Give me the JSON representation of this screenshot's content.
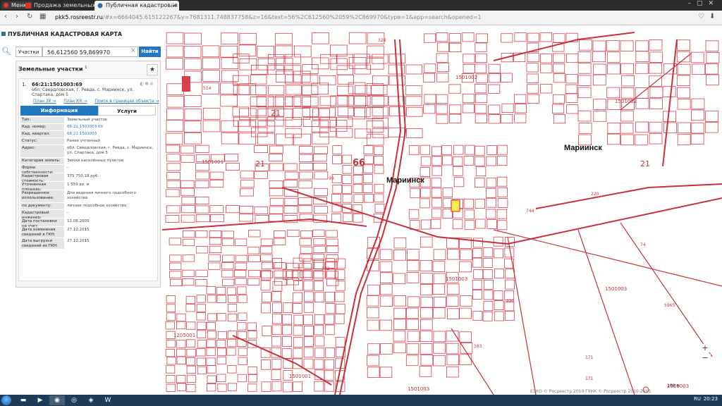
{
  "browser": {
    "menu_label": "Меню",
    "tabs": [
      {
        "title": "Продажа земельных уч..."
      },
      {
        "title": "Публичная кадастровая к..."
      }
    ],
    "new_tab": "+",
    "url_host": "pkk5.rosreestr.ru",
    "url_rest": "/#x=6664045.615122267&y=7681311.748837758&z=16&text=56%2C612560%2059%2C869970&type=1&app=search&opened=1"
  },
  "app": {
    "title": "ПУБЛИЧНАЯ КАДАСТРОВАЯ КАРТА",
    "search_type": "Участки",
    "search_query": "56,612560 59,869970",
    "search_button": "Найти",
    "results_title": "Земельные участки",
    "results_count": "1"
  },
  "parcel": {
    "index": "1.",
    "id": "66:21:1501003:69",
    "address": "обл. Свердловская, г. Ревда, с. Мариинск, ул. Спартака, дом 5",
    "link_plan_zu": "План ЗУ →",
    "link_plan_kk": "План КК →",
    "link_search_bounds": "Поиск в границах объекта →",
    "tab_info": "Информация",
    "tab_services": "Услуги",
    "fields": [
      {
        "k": "Тип:",
        "v": "Земельный участок"
      },
      {
        "k": "Кад. номер:",
        "v": "66:21:1501003:69",
        "link": true
      },
      {
        "k": "Кад. квартал:",
        "v": "66:21:1501003",
        "link": true
      },
      {
        "k": "Статус:",
        "v": "Ранее учтенный"
      },
      {
        "k": "Адрес:",
        "v": "обл. Свердловская, г. Ревда, с. Мариинск, ул. Спартака, дом 5"
      },
      {
        "k": "Категория земель:",
        "v": "Земли населённых пунктов"
      },
      {
        "k": "Форма собственности:",
        "v": "-"
      },
      {
        "k": "Кадастровая стоимость:",
        "v": "375 750,18 руб."
      },
      {
        "k": "Уточненная площадь:",
        "v": "1 559 кв. м"
      },
      {
        "k": "Разрешенное использование:",
        "v": "Для ведения личного подсобного хозяйства"
      },
      {
        "k": "по документу:",
        "v": "личное подсобное хозяйство"
      },
      {
        "k": "Кадастровый инженер:",
        "v": "-"
      },
      {
        "k": "Дата постановки на учет:",
        "v": "12.08.2005"
      },
      {
        "k": "Дата изменения сведений в ГКН:",
        "v": "27.10.2015"
      },
      {
        "k": "Дата выгрузки сведений из ГКН:",
        "v": "27.10.2015"
      }
    ]
  },
  "map": {
    "places": [
      "Мариинск",
      "Мариинск"
    ],
    "big_numbers": [
      "66",
      "21",
      "21",
      "21"
    ],
    "quarters": [
      "1501002",
      "1501002",
      "1501001",
      "1501003",
      "1501003",
      "1501003",
      "1205001",
      "1501001",
      "1501003",
      "1501003"
    ],
    "small_labels": [
      "328",
      "514",
      "220",
      "744",
      "74",
      "122",
      "220",
      "5965",
      "171",
      "171",
      "163",
      "99"
    ],
    "copyright": "ЕЭКО © Росреестр 2010 ГУНК © Росреестр 2010-2015",
    "scale": "100 м",
    "zoom_in": "+",
    "zoom_out": "−"
  },
  "taskbar": {
    "lang": "RU",
    "time": "20:23"
  },
  "colors": {
    "parcel_line": "#d8404a",
    "selected_parcel": "#f7ea4b",
    "accent": "#2377c1"
  }
}
